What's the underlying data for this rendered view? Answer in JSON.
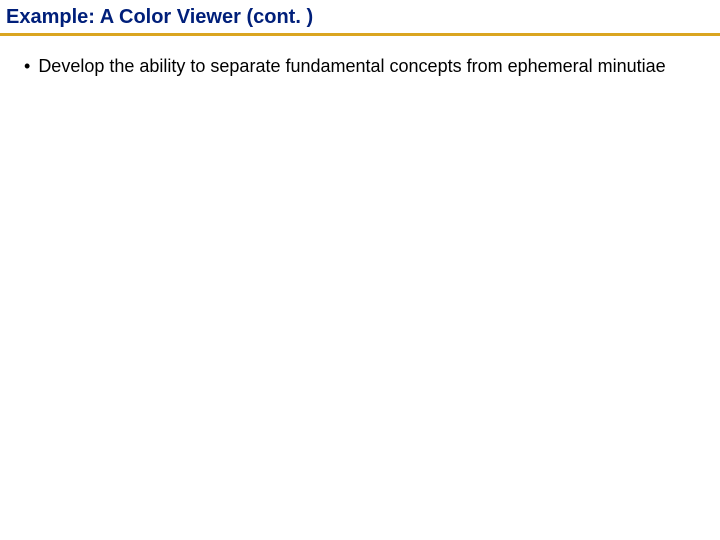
{
  "slide": {
    "title": "Example: A Color Viewer  (cont. )",
    "bullets": [
      {
        "text": "Develop the ability to separate fundamental concepts from ephemeral minutiae"
      }
    ]
  },
  "marker": "•"
}
